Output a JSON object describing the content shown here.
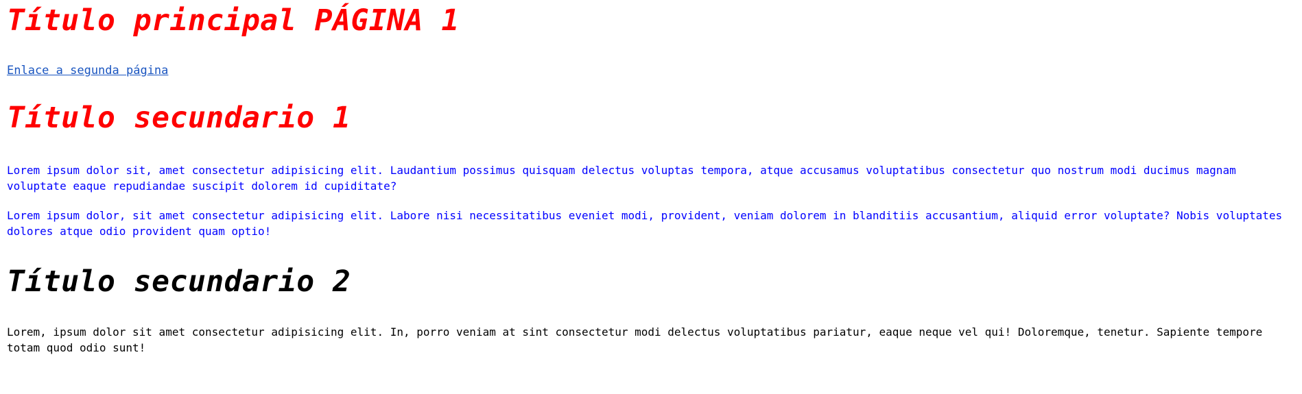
{
  "page": {
    "main_title": "Título principal PÁGINA 1",
    "link_text": "Enlace a segunda página",
    "section1": {
      "title": "Título secundario 1",
      "paragraphs": [
        "Lorem ipsum dolor sit, amet consectetur adipisicing elit. Laudantium possimus quisquam delectus voluptas tempora, atque accusamus voluptatibus consectetur quo nostrum modi ducimus magnam voluptate eaque repudiandae suscipit dolorem id cupiditate?",
        "Lorem ipsum dolor, sit amet consectetur adipisicing elit. Labore nisi necessitatibus eveniet modi, provident, veniam dolorem in blanditiis accusantium, aliquid error voluptate? Nobis voluptates dolores atque odio provident quam optio!"
      ]
    },
    "section2": {
      "title": "Título secundario 2",
      "paragraphs": [
        "Lorem, ipsum dolor sit amet consectetur adipisicing elit. In, porro veniam at sint consectetur modi delectus voluptatibus pariatur, eaque neque vel qui! Doloremque, tenetur. Sapiente tempore totam quod odio sunt!"
      ]
    },
    "colors": {
      "title_red": "#ff0000",
      "paragraph_blue": "#0000ff",
      "link_blue": "#1a55c0",
      "title_black": "#000000"
    }
  }
}
